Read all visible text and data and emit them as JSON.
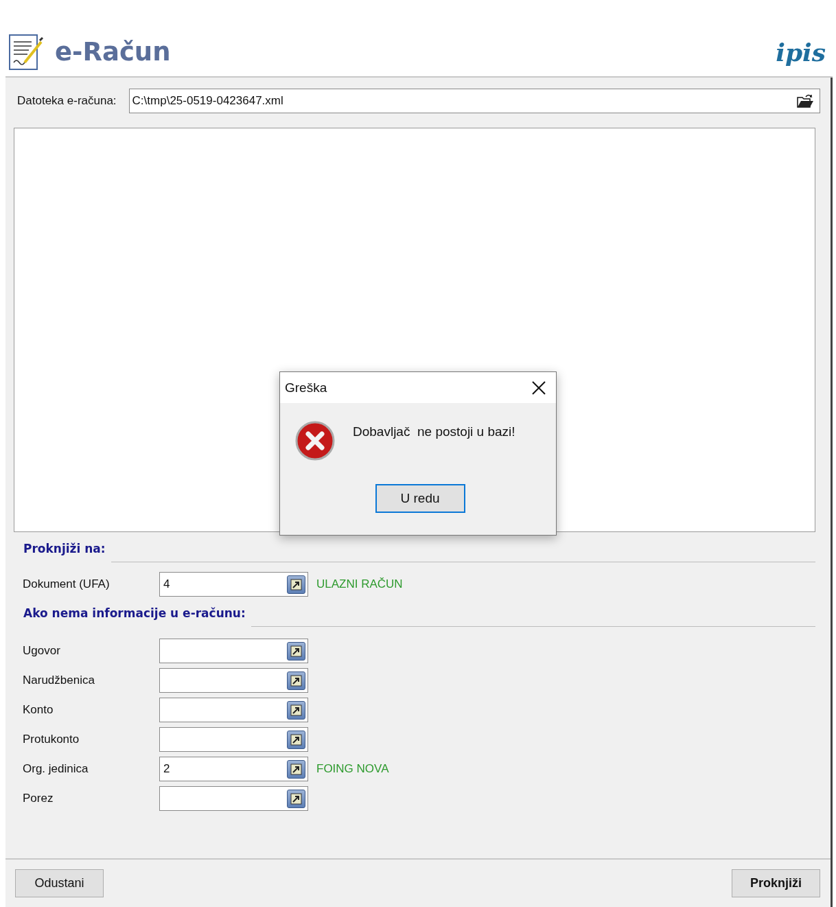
{
  "header": {
    "title": "e-Račun",
    "logo": "ipis"
  },
  "file": {
    "label": "Datoteka e-računa:",
    "value": "C:\\tmp\\25-0519-0423647.xml"
  },
  "section_post": {
    "title": "Proknjiži na:"
  },
  "document": {
    "label": "Dokument (UFA)",
    "value": "4",
    "description": "ULAZNI RAČUN"
  },
  "section_fallback": {
    "title": "Ako nema informacije u e-računu:"
  },
  "fields": [
    {
      "label": "Ugovor"
    },
    {
      "label": "Narudžbenica"
    },
    {
      "label": "Konto"
    },
    {
      "label": "Protukonto"
    },
    {
      "label": "Org. jedinica",
      "value": "2",
      "description": "FOING NOVA"
    },
    {
      "label": "Porez"
    }
  ],
  "buttons": {
    "cancel": "Odustani",
    "post": "Proknjiži"
  },
  "dialog": {
    "title": "Greška",
    "message": "Dobavljač  ne postoji u bazi!",
    "button": "U redu"
  }
}
